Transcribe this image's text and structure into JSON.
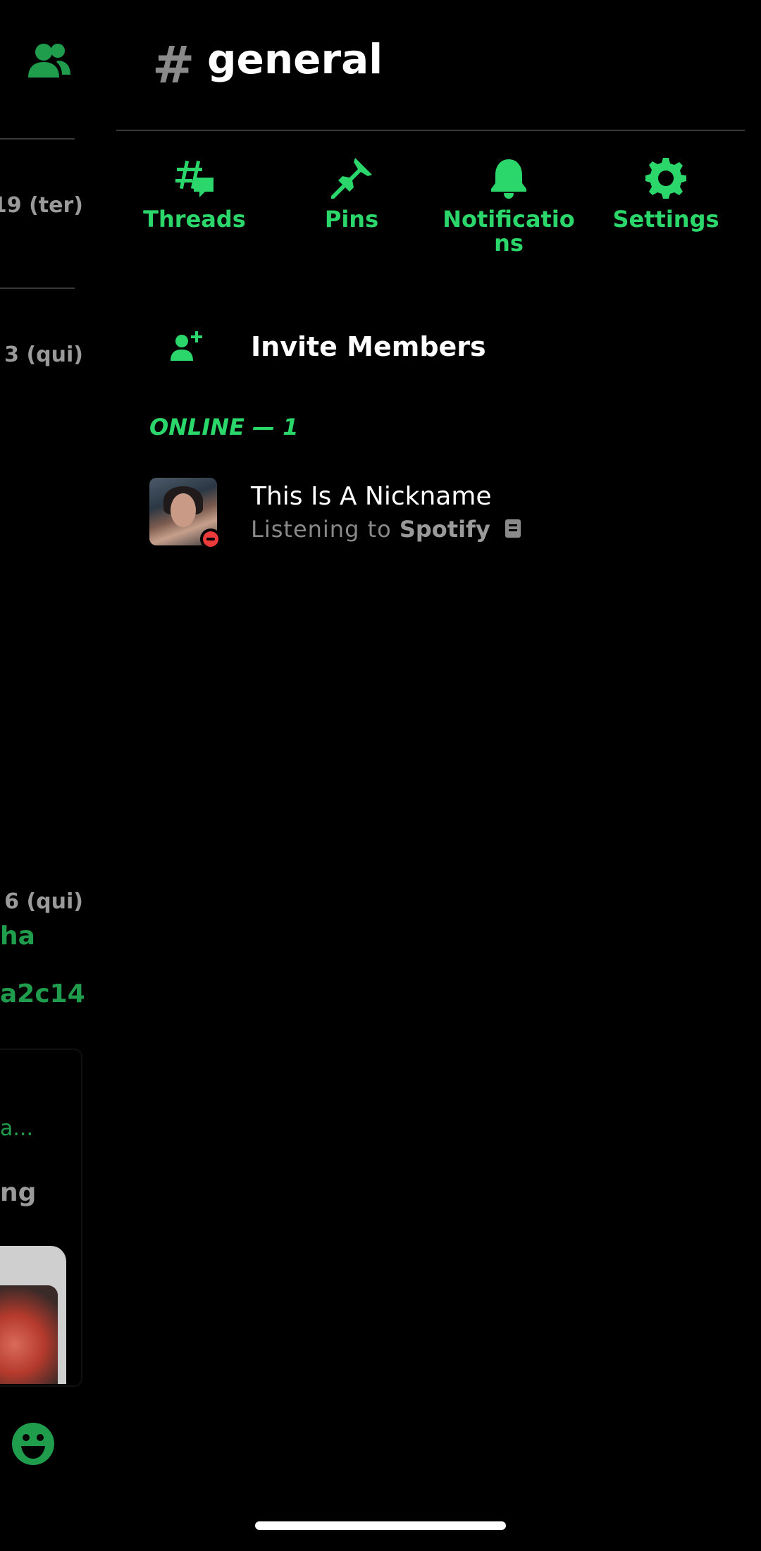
{
  "colors": {
    "accent": "#2bd66a",
    "peek_accent": "#1f9d4d",
    "background": "#000000",
    "muted_text": "#8a8a8a",
    "divider": "#3a3a3a",
    "dnd_status": "#ed3b3b"
  },
  "peek_pane": {
    "members_icon": "members-icon",
    "dates": [
      "19 (ter)",
      "3 (qui)",
      "6 (qui)"
    ],
    "green_lines": [
      "ha",
      "a2c14"
    ],
    "card_lines": [
      "a...",
      "ng"
    ],
    "emoji_icon": "emoji-icon"
  },
  "channel": {
    "hash": "#",
    "name": "general"
  },
  "actions": [
    {
      "icon": "threads-icon",
      "label": "Threads"
    },
    {
      "icon": "pin-icon",
      "label": "Pins"
    },
    {
      "icon": "bell-icon",
      "label": "Notifications"
    },
    {
      "icon": "gear-icon",
      "label": "Settings"
    }
  ],
  "invite": {
    "icon": "add-person-icon",
    "label": "Invite Members"
  },
  "online_section": {
    "header": "ONLINE — 1"
  },
  "members": [
    {
      "name": "This Is A Nickname",
      "activity_prefix": "Listening to",
      "activity_app": "Spotify",
      "status": "dnd",
      "activity_icon": "rich-presence-icon"
    }
  ]
}
